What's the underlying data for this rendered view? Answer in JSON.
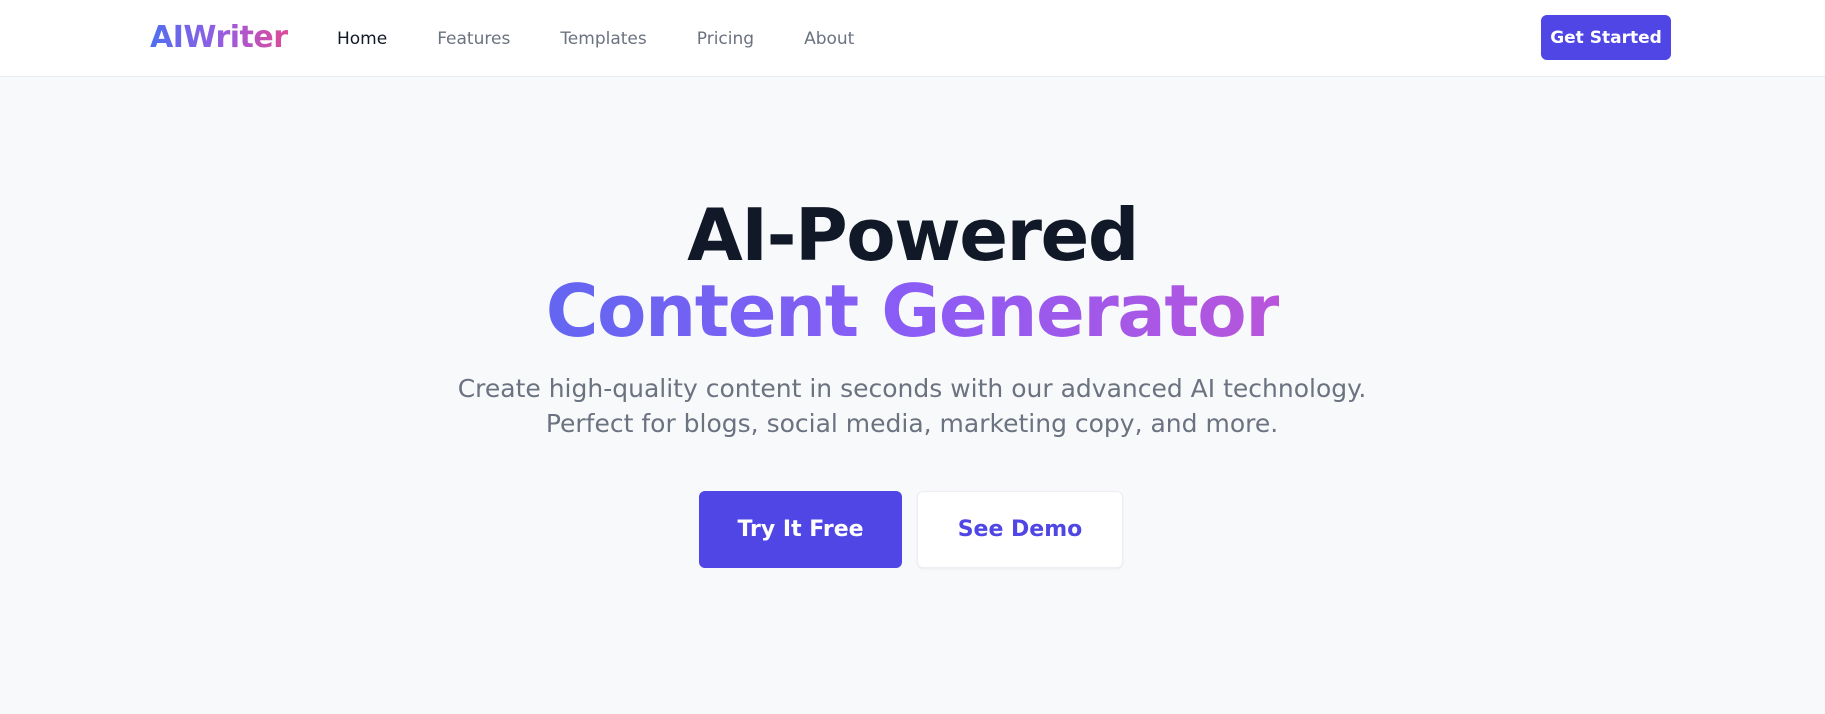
{
  "header": {
    "logo": "AIWriter",
    "nav": [
      {
        "label": "Home",
        "active": true
      },
      {
        "label": "Features",
        "active": false
      },
      {
        "label": "Templates",
        "active": false
      },
      {
        "label": "Pricing",
        "active": false
      },
      {
        "label": "About",
        "active": false
      }
    ],
    "cta_label": "Get Started"
  },
  "hero": {
    "title_line1": "AI-Powered",
    "title_line2": "Content Generator",
    "subtitle": "Create high-quality content in seconds with our advanced AI technology. Perfect for blogs, social media, marketing copy, and more.",
    "primary_button": "Try It Free",
    "secondary_button": "See Demo"
  },
  "colors": {
    "accent": "#4f46e5",
    "heading": "#111827",
    "muted": "#6b7280",
    "background": "#f8f9fb",
    "gradient_start": "#6366f1",
    "gradient_end": "#b855db"
  }
}
